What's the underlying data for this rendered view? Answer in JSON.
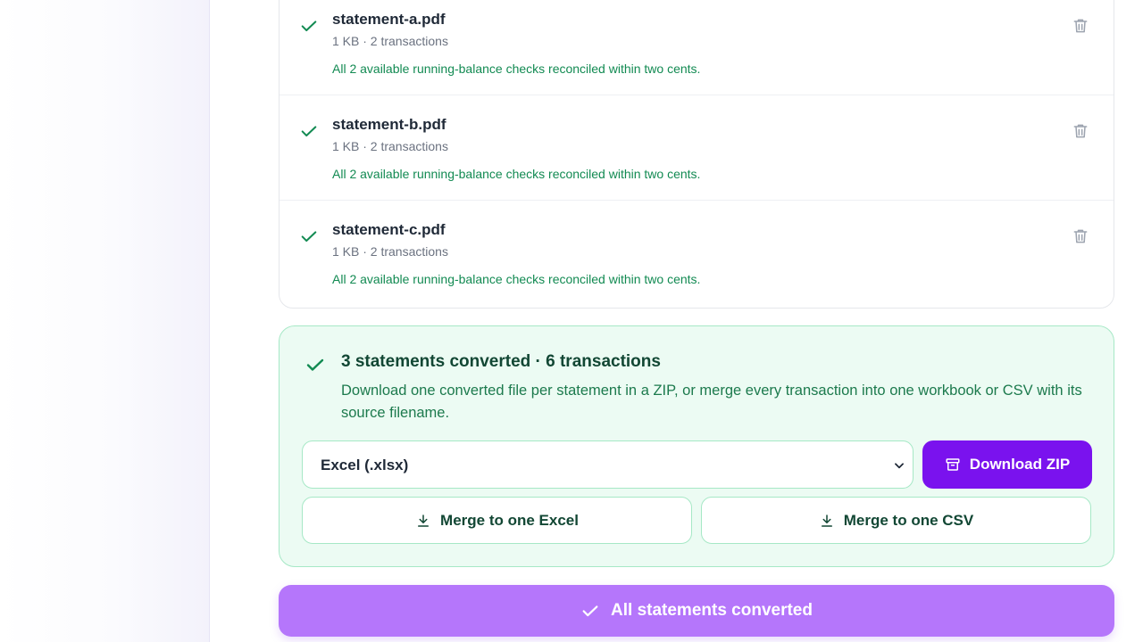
{
  "files": [
    {
      "name": "statement-a.pdf",
      "meta": "1 KB · 2 transactions",
      "note": "All 2 available running-balance checks reconciled within two cents."
    },
    {
      "name": "statement-b.pdf",
      "meta": "1 KB · 2 transactions",
      "note": "All 2 available running-balance checks reconciled within two cents."
    },
    {
      "name": "statement-c.pdf",
      "meta": "1 KB · 2 transactions",
      "note": "All 2 available running-balance checks reconciled within two cents."
    }
  ],
  "summary": {
    "title": "3 statements converted · 6 transactions",
    "description": "Download one converted file per statement in a ZIP, or merge every transaction into one workbook or CSV with its source filename.",
    "format_selected": "Excel (.xlsx)",
    "download_zip_label": "Download ZIP",
    "merge_excel_label": "Merge to one Excel",
    "merge_csv_label": "Merge to one CSV"
  },
  "convert_button_label": "All statements converted",
  "icons": {
    "file_status": "check-icon",
    "file_delete": "trash-icon",
    "summary_status": "check-icon",
    "select_arrow": "chevron-down-icon",
    "zip": "archive-icon",
    "merge": "download-icon",
    "convert": "check-icon"
  },
  "colors": {
    "success": "#128a52",
    "primary": "#7a12ee",
    "primary_muted": "#b576fb",
    "summary_bg": "#ecfbf3",
    "summary_border": "#a6e8c6"
  }
}
